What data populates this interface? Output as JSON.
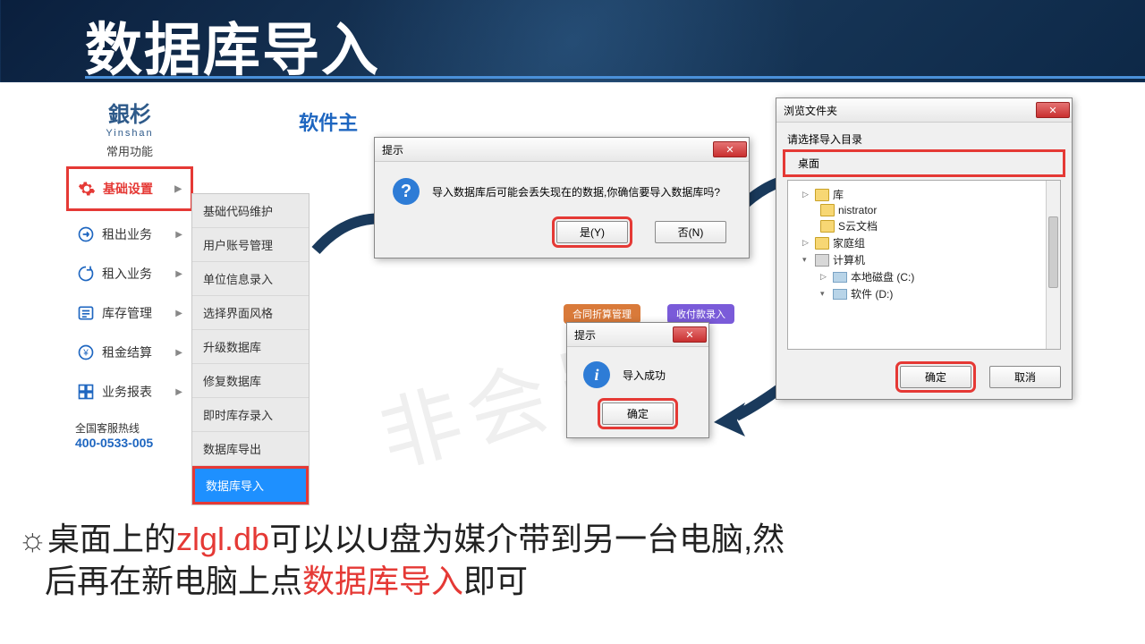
{
  "title": "数据库导入",
  "top_label": "软件主",
  "watermark": "非会员",
  "sidebar": {
    "logo_cn": "銀杉",
    "logo_py": "Yinshan",
    "logo_sub": "常用功能",
    "items": [
      {
        "label": "基础设置",
        "red": true
      },
      {
        "label": "租出业务"
      },
      {
        "label": "租入业务"
      },
      {
        "label": "库存管理"
      },
      {
        "label": "租金结算"
      },
      {
        "label": "业务报表"
      }
    ],
    "hotline_label": "全国客服热线",
    "hotline_num": "400-0533-005"
  },
  "submenu": {
    "items": [
      "基础代码维护",
      "用户账号管理",
      "单位信息录入",
      "选择界面风格",
      "升级数据库",
      "修复数据库",
      "即时库存录入",
      "数据库导出",
      "数据库导入"
    ],
    "active": "数据库导入"
  },
  "dlg1": {
    "title": "提示",
    "msg": "导入数据库后可能会丢失现在的数据,你确信要导入数据库吗?",
    "yes": "是(Y)",
    "no": "否(N)"
  },
  "dlg2": {
    "title": "提示",
    "msg": "导入成功",
    "ok": "确定"
  },
  "dlg3": {
    "title": "浏览文件夹",
    "prompt": "请选择导入目录",
    "selected": "桌面",
    "tree": {
      "lib": "库",
      "admin": "nistrator",
      "cloud_doc": "S云文档",
      "family": "家庭组",
      "computer": "计算机",
      "local_c": "本地磁盘 (C:)",
      "soft_d": "软件 (D:)"
    },
    "ok": "确定",
    "cancel": "取消"
  },
  "bg_tabs": {
    "t1": "合同折算管理",
    "t2": "收付款录入"
  },
  "bottom": {
    "prefix": "桌面上的",
    "file": "zlgl.db",
    "mid": "可以以U盘为媒介带到另一台电脑,然",
    "line2a": "后再在新电脑上点",
    "action": "数据库导入",
    "suffix": "即可"
  }
}
